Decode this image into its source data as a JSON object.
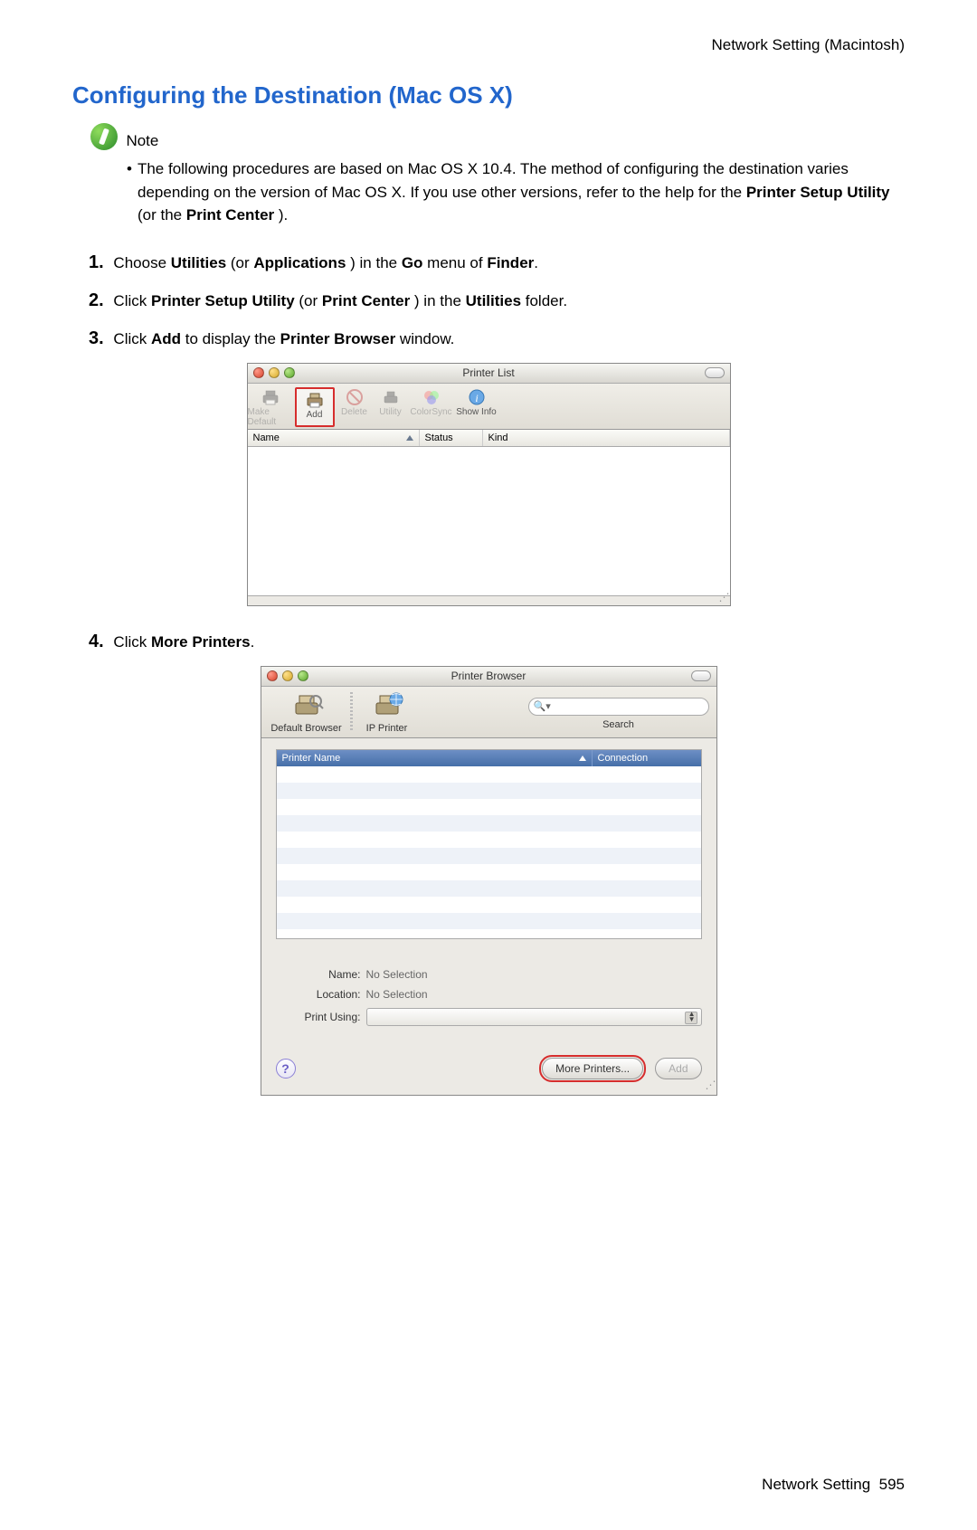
{
  "header": {
    "breadcrumb": "Network Setting (Macintosh)"
  },
  "section": {
    "title": "Configuring the Destination (Mac OS X)"
  },
  "note": {
    "label": "Note",
    "text_a": "The following procedures are based on Mac OS X 10.4. The method of configuring the destination varies depending on the version of Mac OS X. If you use other versions, refer to the help for the ",
    "text_b": "Printer Setup Utility",
    "text_c": " (or the ",
    "text_d": "Print Center",
    "text_e": " )."
  },
  "steps": {
    "s1": {
      "num": "1.",
      "a": "Choose ",
      "b": "Utilities",
      "c": " (or ",
      "d": "Applications",
      "e": " ) in the ",
      "f": "Go",
      "g": " menu of ",
      "h": "Finder",
      "i": "."
    },
    "s2": {
      "num": "2.",
      "a": "Click ",
      "b": "Printer Setup Utility",
      "c": " (or ",
      "d": "Print Center",
      "e": " ) in the ",
      "f": "Utilities",
      "g": " folder."
    },
    "s3": {
      "num": "3.",
      "a": "Click ",
      "b": "Add",
      "c": " to display the ",
      "d": "Printer Browser",
      "e": " window."
    },
    "s4": {
      "num": "4.",
      "a": "Click ",
      "b": "More Printers",
      "c": "."
    }
  },
  "printer_list": {
    "title": "Printer List",
    "toolbar": {
      "make_default": "Make Default",
      "add": "Add",
      "delete": "Delete",
      "utility": "Utility",
      "colorsync": "ColorSync",
      "show_info": "Show Info"
    },
    "columns": {
      "name": "Name",
      "status": "Status",
      "kind": "Kind"
    }
  },
  "printer_browser": {
    "title": "Printer Browser",
    "toolbar": {
      "default_browser": "Default Browser",
      "ip_printer": "IP Printer",
      "search_label": "Search",
      "search_placeholder": ""
    },
    "columns": {
      "printer_name": "Printer Name",
      "connection": "Connection"
    },
    "form": {
      "name_label": "Name:",
      "name_value": "No Selection",
      "location_label": "Location:",
      "location_value": "No Selection",
      "print_using_label": "Print Using:"
    },
    "buttons": {
      "more_printers": "More Printers...",
      "add": "Add",
      "help": "?"
    }
  },
  "footer": {
    "section": "Network Setting",
    "page": "595"
  }
}
